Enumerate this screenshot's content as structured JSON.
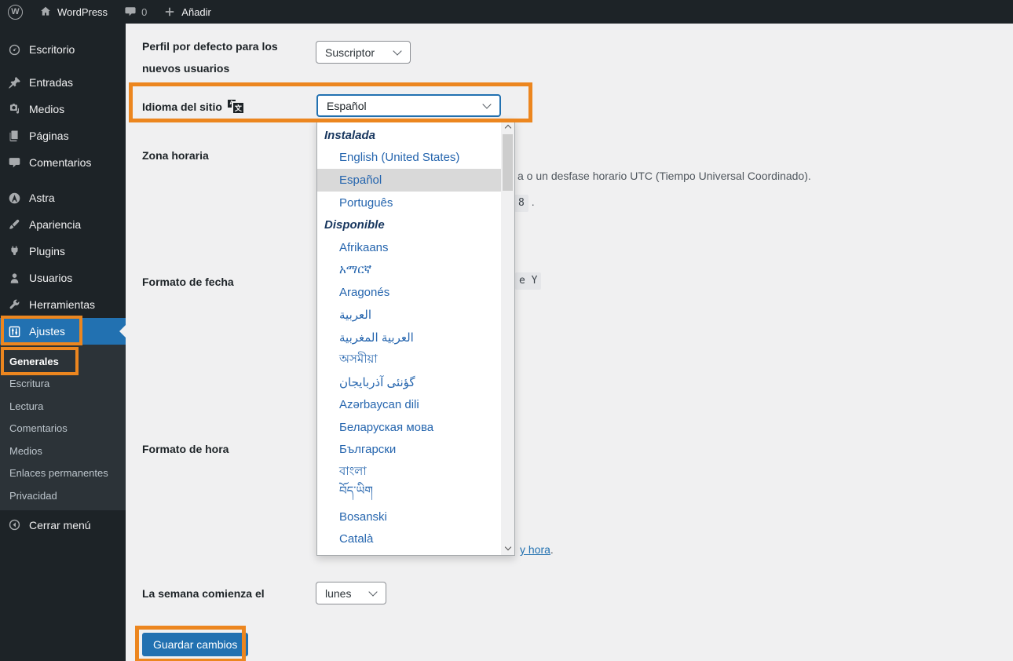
{
  "admin_bar": {
    "logo_glyph": "W",
    "site_name": "WordPress",
    "comments_count": "0",
    "new_label": "Añadir"
  },
  "sidebar": {
    "items": [
      {
        "label": "Escritorio",
        "icon": "dashboard-icon"
      },
      {
        "label": "Entradas",
        "icon": "pin-icon"
      },
      {
        "label": "Medios",
        "icon": "media-icon"
      },
      {
        "label": "Páginas",
        "icon": "pages-icon"
      },
      {
        "label": "Comentarios",
        "icon": "comments-icon"
      },
      {
        "label": "Astra",
        "icon": "astra-icon"
      },
      {
        "label": "Apariencia",
        "icon": "appearance-icon"
      },
      {
        "label": "Plugins",
        "icon": "plugin-icon"
      },
      {
        "label": "Usuarios",
        "icon": "users-icon"
      },
      {
        "label": "Herramientas",
        "icon": "tools-icon"
      },
      {
        "label": "Ajustes",
        "icon": "settings-icon",
        "active": true
      }
    ],
    "submenu": [
      {
        "label": "Generales",
        "active": true
      },
      {
        "label": "Escritura"
      },
      {
        "label": "Lectura"
      },
      {
        "label": "Comentarios"
      },
      {
        "label": "Medios"
      },
      {
        "label": "Enlaces permanentes"
      },
      {
        "label": "Privacidad"
      }
    ],
    "collapse_label": "Cerrar menú"
  },
  "settings": {
    "default_role": {
      "label_line1": "Perfil por defecto para los",
      "label_line2": "nuevos usuarios",
      "value": "Suscriptor"
    },
    "site_language": {
      "label": "Idioma del sitio",
      "value": "Español",
      "icon_front_glyph": "文",
      "icon_back_glyph": "A"
    },
    "timezone": {
      "label": "Zona horaria",
      "desc_fragment": "a o un desfase horario UTC (Tiempo Universal Coordinado).",
      "utc_code_fragment": "8",
      "utc_after": "."
    },
    "date_format": {
      "label": "Formato de fecha",
      "code_fragment": "e Y"
    },
    "time_format": {
      "label": "Formato de hora",
      "doc_link_fragment": "y hora",
      "doc_after": "."
    },
    "week_start": {
      "label": "La semana comienza el",
      "value": "lunes"
    },
    "save_button": "Guardar cambios"
  },
  "language_dropdown": {
    "rows": [
      {
        "type": "group",
        "label": "Instalada"
      },
      {
        "type": "option",
        "label": "English (United States)"
      },
      {
        "type": "option",
        "label": "Español",
        "selected": true
      },
      {
        "type": "option",
        "label": "Português"
      },
      {
        "type": "group",
        "label": "Disponible"
      },
      {
        "type": "option",
        "label": "Afrikaans"
      },
      {
        "type": "option",
        "label": "አማርኛ"
      },
      {
        "type": "option",
        "label": "Aragonés"
      },
      {
        "type": "option",
        "label": "العربية"
      },
      {
        "type": "option",
        "label": "العربية المغربية"
      },
      {
        "type": "option",
        "label": "অসমীয়া"
      },
      {
        "type": "option",
        "label": "گؤنئی آذربایجان"
      },
      {
        "type": "option",
        "label": "Azərbaycan dili"
      },
      {
        "type": "option",
        "label": "Беларуская мова"
      },
      {
        "type": "option",
        "label": "Български"
      },
      {
        "type": "option",
        "label": "বাংলা"
      },
      {
        "type": "option",
        "label": "བོད་ཡིག"
      },
      {
        "type": "option",
        "label": "Bosanski"
      },
      {
        "type": "option",
        "label": "Català"
      }
    ]
  },
  "colors": {
    "accent_orange": "#ec861f",
    "wp_blue": "#2271b1",
    "sidebar_bg": "#1d2327",
    "submenu_bg": "#2c3338",
    "content_bg": "#f0f0f1",
    "option_blue": "#2565ae",
    "group_navy": "#18375f",
    "selected_row_bg": "#d9d9d9"
  }
}
